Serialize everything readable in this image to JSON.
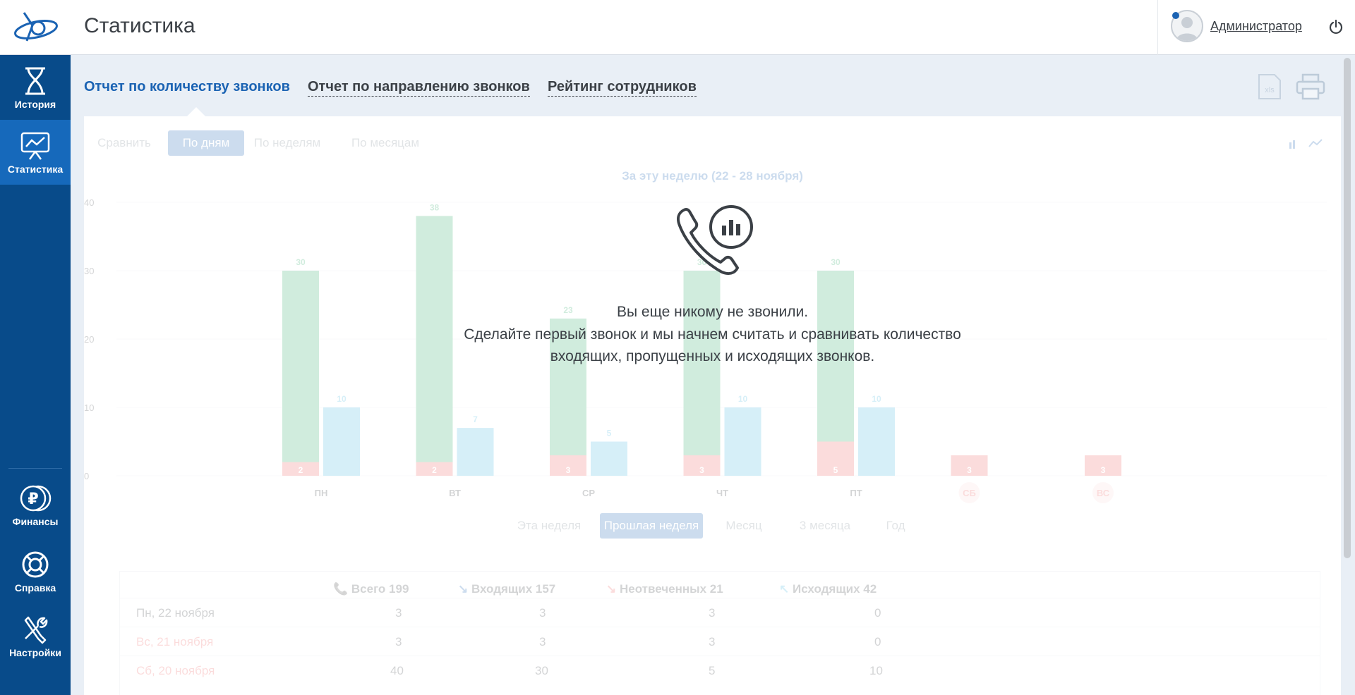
{
  "header": {
    "title": "Статистика",
    "user_name": "Администратор"
  },
  "sidebar": {
    "items": [
      {
        "label": "История",
        "icon": "hourglass-icon"
      },
      {
        "label": "Статистика",
        "icon": "chart-board-icon"
      },
      {
        "label": "Финансы",
        "icon": "ruble-coins-icon"
      },
      {
        "label": "Справка",
        "icon": "lifebuoy-icon"
      },
      {
        "label": "Настройки",
        "icon": "tools-icon"
      }
    ]
  },
  "tabs": [
    {
      "label": "Отчет по количеству звонков",
      "active": true
    },
    {
      "label": "Отчет по направлению звонков",
      "active": false
    },
    {
      "label": "Рейтинг сотрудников",
      "active": false
    }
  ],
  "group_by": {
    "compare": "Сравнить",
    "options": [
      "По дням",
      "По неделям",
      "По месяцам"
    ],
    "selected": "По дням"
  },
  "period": {
    "options": [
      "Эта неделя",
      "Прошлая неделя",
      "Месяц",
      "3 месяца",
      "Год"
    ],
    "selected": "Прошлая неделя"
  },
  "chart_data": {
    "type": "bar",
    "title": "За эту неделю (22 - 28 ноября)",
    "categories": [
      "ПН",
      "ВТ",
      "СР",
      "ЧТ",
      "ПТ",
      "СБ",
      "ВС"
    ],
    "ylim": [
      0,
      40
    ],
    "yticks": [
      0,
      10,
      20,
      30,
      40
    ],
    "series": [
      {
        "values": [
          30,
          38,
          23,
          30,
          30,
          null,
          null
        ],
        "color": "#2eaa6a"
      },
      {
        "values": [
          2,
          2,
          3,
          3,
          5,
          3,
          3
        ],
        "color": "#f06565"
      },
      {
        "values": [
          10,
          7,
          5,
          10,
          10,
          null,
          null
        ],
        "color": "#4ab8e0"
      }
    ]
  },
  "table": {
    "headers": [
      "Всего 199",
      "Входящих 157",
      "Неотвеченных 21",
      "Исходящих 42"
    ],
    "rows": [
      {
        "date": "Пн, 22 ноября",
        "values": [
          "3",
          "3",
          "3",
          "0"
        ],
        "weekend": false
      },
      {
        "date": "Вс, 21 ноября",
        "values": [
          "3",
          "3",
          "3",
          "0"
        ],
        "weekend": true
      },
      {
        "date": "Сб, 20 ноября",
        "values": [
          "40",
          "30",
          "5",
          "10"
        ],
        "weekend": true
      }
    ]
  },
  "empty_state": {
    "line1": "Вы еще никому не звонили.",
    "line2": "Сделайте первый звонок и мы начнем считать и сравнивать количество",
    "line3": "входящих, пропущенных и исходящих звонков."
  }
}
